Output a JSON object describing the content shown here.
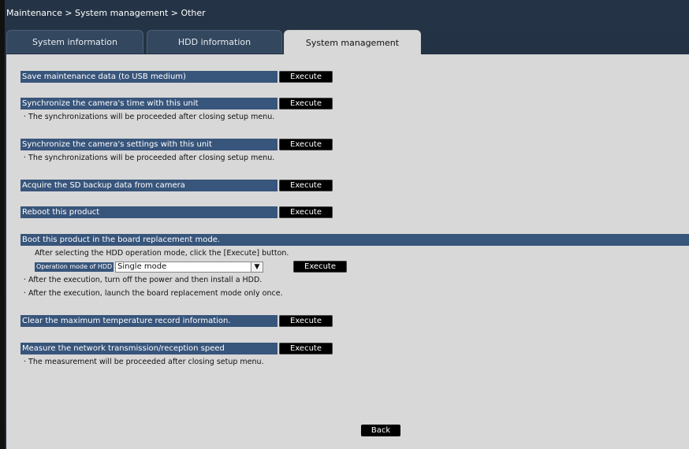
{
  "breadcrumb": "Maintenance > System management > Other",
  "tabs": [
    {
      "label": "System information"
    },
    {
      "label": "HDD information"
    },
    {
      "label": "System management"
    }
  ],
  "actions": {
    "save_maintenance": "Save maintenance data (to USB medium)",
    "sync_time": "Synchronize the camera's time with this unit",
    "sync_time_note": "· The synchronizations will be proceeded after closing setup menu.",
    "sync_settings": "Synchronize the camera's settings with this unit",
    "sync_settings_note": "· The synchronizations will be proceeded after closing setup menu.",
    "sd_backup": "Acquire the SD backup data from camera",
    "reboot": "Reboot this product",
    "board_replacement": "Boot this product in the board replacement mode.",
    "board_replacement_instruction": "After selecting the HDD operation mode, click the [Execute] button.",
    "hdd_mode_label": "Operation mode of HDD",
    "hdd_mode_value": "Single mode",
    "board_note_1": "· After the execution, turn off the power and then install a HDD.",
    "board_note_2": "· After the execution, launch the board replacement mode only once.",
    "clear_temp": "Clear the maximum temperature record information.",
    "measure_network": "Measure the network transmission/reception speed",
    "measure_network_note": "· The measurement will be proceeded after closing setup menu."
  },
  "execute_label": "Execute",
  "back_label": "Back",
  "colors": {
    "header_bg": "#243446",
    "row_bar": "#38557b",
    "panel_bg": "#d8d8d8",
    "button_bg": "#000000"
  }
}
